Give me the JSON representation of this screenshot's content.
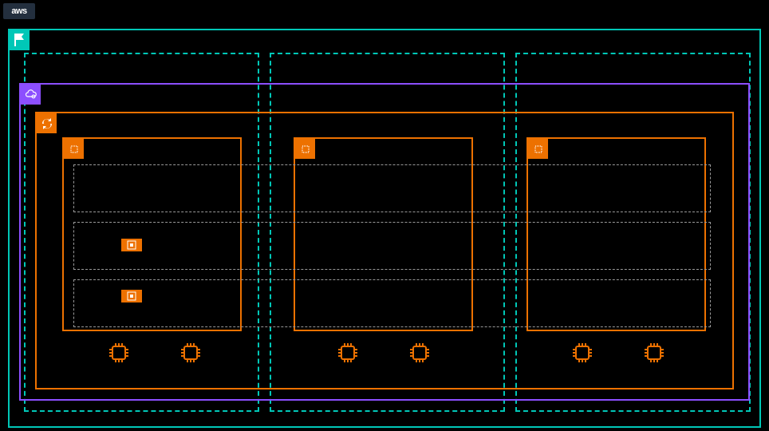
{
  "logo": {
    "text": "aws"
  },
  "colors": {
    "teal": "#00c7b7",
    "purple": "#8c4fff",
    "orange": "#ed7100",
    "gray": "#999999"
  },
  "region": {
    "icon": "flag"
  },
  "azs": [
    {
      "id": "az1"
    },
    {
      "id": "az2"
    },
    {
      "id": "az3"
    }
  ],
  "vpc": {
    "icon": "cloud"
  },
  "asg": {
    "icon": "refresh"
  },
  "instance_groups": [
    {
      "icon": "chip"
    },
    {
      "icon": "chip"
    },
    {
      "icon": "chip"
    }
  ],
  "layers": 3,
  "mini_instances_per_group": 2,
  "outline_chips_per_group": 2
}
